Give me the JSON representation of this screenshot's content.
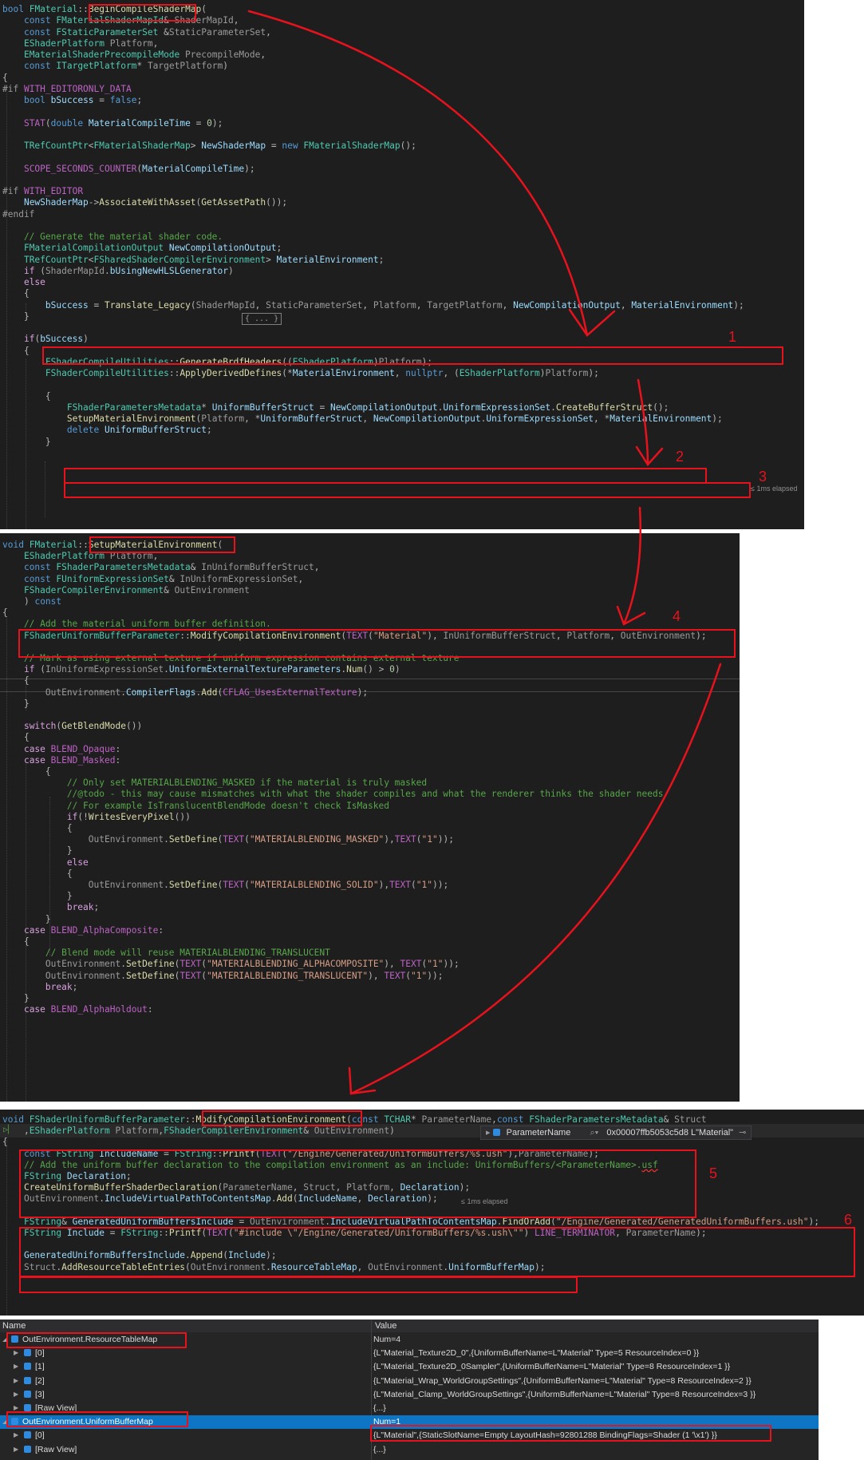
{
  "code_panel_1": {
    "lines": [
      "bool FMaterial::BeginCompileShaderMap(",
      "    const FMaterialShaderMapId& ShaderMapId,",
      "    const FStaticParameterSet &StaticParameterSet,",
      "    EShaderPlatform Platform,",
      "    EMaterialShaderPrecompileMode PrecompileMode,",
      "    const ITargetPlatform* TargetPlatform)",
      "{",
      "#if WITH_EDITORONLY_DATA",
      "    bool bSuccess = false;",
      "",
      "    STAT(double MaterialCompileTime = 0);",
      "",
      "    TRefCountPtr<FMaterialShaderMap> NewShaderMap = new FMaterialShaderMap();",
      "",
      "    SCOPE_SECONDS_COUNTER(MaterialCompileTime);",
      "",
      "#if WITH_EDITOR",
      "    NewShaderMap->AssociateWithAsset(GetAssetPath());",
      "#endif",
      "",
      "    // Generate the material shader code.",
      "    FMaterialCompilationOutput NewCompilationOutput;",
      "    TRefCountPtr<FSharedShaderCompilerEnvironment> MaterialEnvironment;",
      "    if (ShaderMapId.bUsingNewHLSLGenerator)",
      "    else",
      "    {",
      "        bSuccess = Translate_Legacy(ShaderMapId, StaticParameterSet, Platform, TargetPlatform, NewCompilationOutput, MaterialEnvironment);",
      "    }",
      "",
      "    if(bSuccess)",
      "    {",
      "        FShaderCompileUtilities::GenerateBrdfHeaders((EShaderPlatform)Platform);",
      "        FShaderCompileUtilities::ApplyDerivedDefines(*MaterialEnvironment, nullptr, (EShaderPlatform)Platform);",
      "",
      "        {",
      "            FShaderParametersMetadata* UniformBufferStruct = NewCompilationOutput.UniformExpressionSet.CreateBufferStruct();",
      "            SetupMaterialEnvironment(Platform, *UniformBufferStruct, NewCompilationOutput.UniformExpressionSet, *MaterialEnvironment);",
      "            delete UniformBufferStruct;",
      "        }"
    ],
    "fold_label": "{ ... }",
    "elapsed": "≤ 1ms elapsed"
  },
  "code_panel_2": {
    "lines": [
      "void FMaterial::SetupMaterialEnvironment(",
      "    EShaderPlatform Platform,",
      "    const FShaderParametersMetadata& InUniformBufferStruct,",
      "    const FUniformExpressionSet& InUniformExpressionSet,",
      "    FShaderCompilerEnvironment& OutEnvironment",
      "    ) const",
      "{",
      "    // Add the material uniform buffer definition.",
      "    FShaderUniformBufferParameter::ModifyCompilationEnvironment(TEXT(\"Material\"), InUniformBufferStruct, Platform, OutEnvironment);",
      "",
      "    // Mark as using external texture if uniform expression contains external texture",
      "    if (InUniformExpressionSet.UniformExternalTextureParameters.Num() > 0)",
      "    {",
      "        OutEnvironment.CompilerFlags.Add(CFLAG_UsesExternalTexture);",
      "    }",
      "",
      "    switch(GetBlendMode())",
      "    {",
      "    case BLEND_Opaque:",
      "    case BLEND_Masked:",
      "        {",
      "            // Only set MATERIALBLENDING_MASKED if the material is truly masked",
      "            //@todo - this may cause mismatches with what the shader compiles and what the renderer thinks the shader needs",
      "            // For example IsTranslucentBlendMode doesn't check IsMasked",
      "            if(!WritesEveryPixel())",
      "            {",
      "                OutEnvironment.SetDefine(TEXT(\"MATERIALBLENDING_MASKED\"),TEXT(\"1\"));",
      "            }",
      "            else",
      "            {",
      "                OutEnvironment.SetDefine(TEXT(\"MATERIALBLENDING_SOLID\"),TEXT(\"1\"));",
      "            }",
      "            break;",
      "        }",
      "    case BLEND_AlphaComposite:",
      "    {",
      "        // Blend mode will reuse MATERIALBLENDING_TRANSLUCENT",
      "        OutEnvironment.SetDefine(TEXT(\"MATERIALBLENDING_ALPHACOMPOSITE\"), TEXT(\"1\"));",
      "        OutEnvironment.SetDefine(TEXT(\"MATERIALBLENDING_TRANSLUCENT\"), TEXT(\"1\"));",
      "        break;",
      "    }",
      "    case BLEND_AlphaHoldout:"
    ]
  },
  "code_panel_3": {
    "lines": [
      "void FShaderUniformBufferParameter::ModifyCompilationEnvironment(const TCHAR* ParameterName,const FShaderParametersMetadata& Struct",
      "    ,EShaderPlatform Platform,FShaderCompilerEnvironment& OutEnvironment)",
      "{",
      "    const FString IncludeName = FString::Printf(TEXT(\"/Engine/Generated/UniformBuffers/%s.ush\"),ParameterName);",
      "    // Add the uniform buffer declaration to the compilation environment as an include: UniformBuffers/<ParameterName>.usf",
      "    FString Declaration;",
      "    CreateUniformBufferShaderDeclaration(ParameterName, Struct, Platform, Declaration);",
      "    OutEnvironment.IncludeVirtualPathToContentsMap.Add(IncludeName, Declaration);",
      "",
      "    FString& GeneratedUniformBuffersInclude = OutEnvironment.IncludeVirtualPathToContentsMap.FindOrAdd(\"/Engine/Generated/GeneratedUniformBuffers.ush\");",
      "    FString Include = FString::Printf(TEXT(\"#include \\\"/Engine/Generated/UniformBuffers/%s.ush\\\"\") LINE_TERMINATOR, ParameterName);",
      "",
      "    GeneratedUniformBuffersInclude.Append(Include);",
      "    Struct.AddResourceTableEntries(OutEnvironment.ResourceTableMap, OutEnvironment.UniformBufferMap);"
    ],
    "datatip_name": "ParameterName",
    "datatip_value": "0x00007ffb5053c5d8 L\"Material\"",
    "elapsed": "≤ 1ms elapsed"
  },
  "markers": [
    "1",
    "2",
    "3",
    "4",
    "5",
    "6"
  ],
  "watch": {
    "col_name": "Name",
    "col_value": "Value",
    "rows": [
      {
        "name": "OutEnvironment.ResourceTableMap",
        "value": "Num=4"
      },
      {
        "name": "[0]",
        "value": "{L\"Material_Texture2D_0\",{UniformBufferName=L\"Material\" Type=5 ResourceIndex=0 }}"
      },
      {
        "name": "[1]",
        "value": "{L\"Material_Texture2D_0Sampler\",{UniformBufferName=L\"Material\" Type=8 ResourceIndex=1 }}"
      },
      {
        "name": "[2]",
        "value": "{L\"Material_Wrap_WorldGroupSettings\",{UniformBufferName=L\"Material\" Type=8 ResourceIndex=2 }}"
      },
      {
        "name": "[3]",
        "value": "{L\"Material_Clamp_WorldGroupSettings\",{UniformBufferName=L\"Material\" Type=8 ResourceIndex=3 }}"
      },
      {
        "name": "[Raw View]",
        "value": "{...}"
      },
      {
        "name": "OutEnvironment.UniformBufferMap",
        "value": "Num=1"
      },
      {
        "name": "[0]",
        "value": "{L\"Material\",{StaticSlotName=Empty LayoutHash=92801288 BindingFlags=Shader (1 '\\x1') }}"
      },
      {
        "name": "[Raw View]",
        "value": "{...}"
      }
    ]
  },
  "colors": {
    "annotation": "#e8121d",
    "editor_bg": "#1e1e1e",
    "selection": "#0e74c4"
  }
}
